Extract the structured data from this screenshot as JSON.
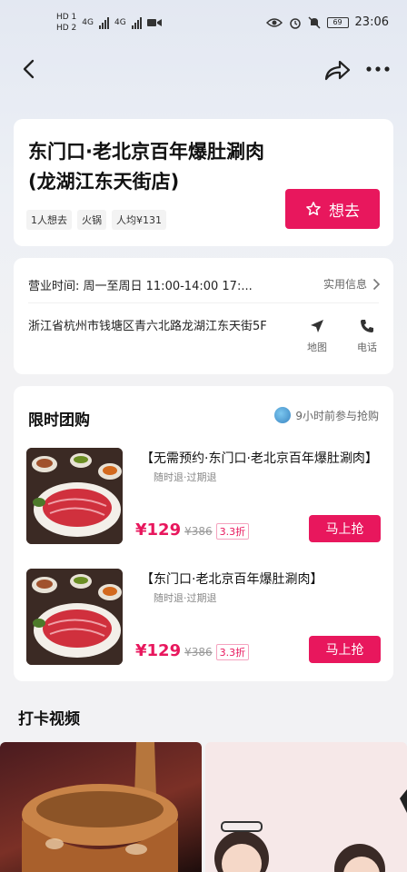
{
  "status_bar": {
    "sim_labels": [
      "HD 1",
      "HD 2"
    ],
    "signal_labels": [
      "4G",
      "4G"
    ],
    "battery": "69",
    "time": "23:06"
  },
  "nav": {
    "back_icon": "chevron-left-icon",
    "share_icon": "share-arrow-icon",
    "more_icon": "more-dots-icon"
  },
  "shop": {
    "title": "东门口·老北京百年爆肚涮肉(龙湖江东天街店)",
    "tags": [
      "1人想去",
      "火锅",
      "人均¥131"
    ],
    "want_label": "想去"
  },
  "info": {
    "hours": "营业时间: 周一至周日 11:00-14:00 17:...",
    "practical_label": "实用信息",
    "address": "浙江省杭州市钱塘区青六北路龙湖江东天街5F",
    "map_label": "地图",
    "phone_label": "电话"
  },
  "deals": {
    "heading": "限时团购",
    "rush_text": "9小时前参与抢购",
    "items": [
      {
        "title": "【无需预约·东门口·老北京百年爆肚涮肉】",
        "sub": "随时退·过期退",
        "price": "¥129",
        "original": "¥386",
        "discount": "3.3折",
        "buy_label": "马上抢"
      },
      {
        "title": "【东门口·老北京百年爆肚涮肉】",
        "sub": "随时退·过期退",
        "price": "¥129",
        "original": "¥386",
        "discount": "3.3折",
        "buy_label": "马上抢"
      }
    ]
  },
  "videos": {
    "heading": "打卡视频"
  },
  "colors": {
    "accent": "#e8175d",
    "background": "#f2f2f4"
  }
}
